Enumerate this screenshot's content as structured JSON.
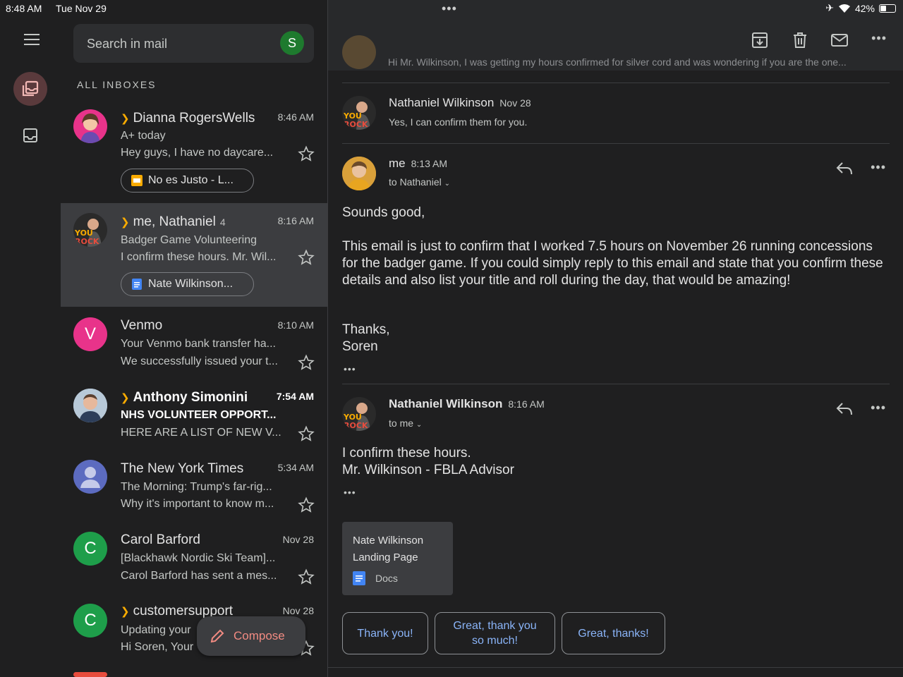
{
  "status": {
    "time": "8:48 AM",
    "date": "Tue Nov 29",
    "battery": "42%",
    "battery_level": 0.42
  },
  "search": {
    "placeholder": "Search in mail",
    "account_initial": "S"
  },
  "list": {
    "section_title": "ALL INBOXES",
    "rows": [
      {
        "sender": "Dianna RogersWells",
        "time": "8:46 AM",
        "subject": "A+ today",
        "snippet": "Hey guys, I have no daycare...",
        "attachment": "No es Justo - L...",
        "important": true,
        "unread": false
      },
      {
        "sender": "me, Nathaniel",
        "count": "4",
        "time": "8:16 AM",
        "subject": "Badger Game Volunteering",
        "snippet": "I confirm these hours. Mr. Wil...",
        "attachment": "Nate Wilkinson...",
        "important": true,
        "unread": false,
        "selected": true
      },
      {
        "sender": "Venmo",
        "avatar_letter": "V",
        "time": "8:10 AM",
        "subject": "Your Venmo bank transfer ha...",
        "snippet": "We successfully issued your t...",
        "unread": false
      },
      {
        "sender": "Anthony Simonini",
        "time": "7:54 AM",
        "subject": "NHS VOLUNTEER OPPORT...",
        "snippet": "HERE ARE A LIST OF NEW V...",
        "important": true,
        "unread": true
      },
      {
        "sender": "The New York Times",
        "time": "5:34 AM",
        "subject": "The Morning: Trump's far-rig...",
        "snippet": "Why it's important to know m...",
        "unread": false
      },
      {
        "sender": "Carol Barford",
        "avatar_letter": "C",
        "time": "Nov 28",
        "subject": "[Blackhawk Nordic Ski Team]...",
        "snippet": "Carol Barford has sent a mes...",
        "unread": false
      },
      {
        "sender": "customersupport",
        "avatar_letter": "C",
        "time": "Nov 28",
        "subject": "Updating your",
        "snippet": "Hi Soren, Your",
        "important": true,
        "unread": false
      }
    ],
    "compose_label": "Compose"
  },
  "thread": {
    "collapsed_snippet": "Hi Mr. Wilkinson, I was getting my hours confirmed for silver cord and was wondering if you are the one...",
    "messages": [
      {
        "from": "Nathaniel Wilkinson",
        "date": "Nov 28",
        "preview": "Yes, I can confirm them for you."
      },
      {
        "from": "me",
        "date": "8:13 AM",
        "to": "to Nathaniel",
        "body": [
          "Sounds good,",
          "This email is just to confirm that I worked 7.5 hours on November 26 running concessions for the badger game. If you could simply reply to this email and state that you confirm these details and also list your title and roll during the day, that would be amazing!",
          "Thanks,",
          "Soren"
        ]
      },
      {
        "from": "Nathaniel Wilkinson",
        "date": "8:16 AM",
        "to": "to me",
        "body": [
          "I confirm these hours.",
          "Mr. Wilkinson - FBLA Advisor"
        ]
      }
    ],
    "attachment": {
      "line1": "Nate Wilkinson",
      "line2": "Landing Page",
      "type": "Docs"
    },
    "smart_replies": [
      "Thank you!",
      "Great, thank you so much!",
      "Great, thanks!"
    ]
  },
  "colors": {
    "accent_red": "#f28b82",
    "link_blue": "#8ab4f8",
    "important_yellow": "#f9ab00",
    "avatar_green": "#1e7a2e"
  }
}
